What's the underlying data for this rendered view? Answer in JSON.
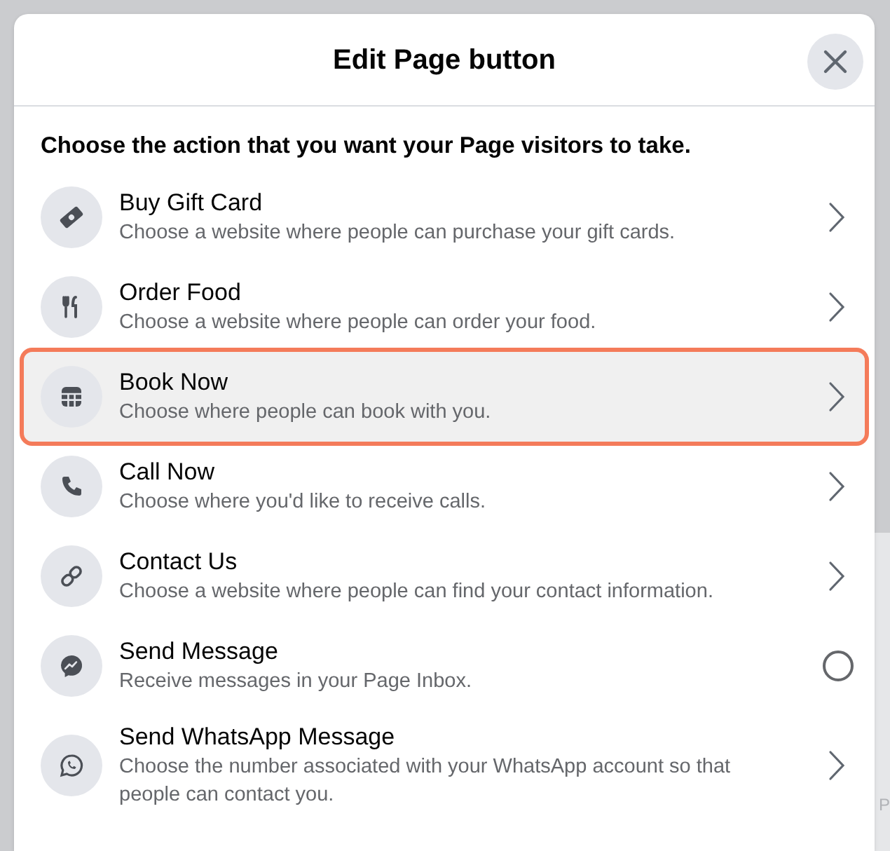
{
  "dialog": {
    "title": "Edit Page button",
    "prompt": "Choose the action that you want your Page visitors to take.",
    "options": [
      {
        "title": "Buy Gift Card",
        "description": "Choose a website where people can purchase your gift cards.",
        "kind": "chevron",
        "highlighted": false
      },
      {
        "title": "Order Food",
        "description": "Choose a website where people can order your food.",
        "kind": "chevron",
        "highlighted": false
      },
      {
        "title": "Book Now",
        "description": "Choose where people can book with you.",
        "kind": "chevron",
        "highlighted": true
      },
      {
        "title": "Call Now",
        "description": "Choose where you'd like to receive calls.",
        "kind": "chevron",
        "highlighted": false
      },
      {
        "title": "Contact Us",
        "description": "Choose a website where people can find your contact information.",
        "kind": "chevron",
        "highlighted": false
      },
      {
        "title": "Send Message",
        "description": "Receive messages in your Page Inbox.",
        "kind": "radio",
        "highlighted": false
      },
      {
        "title": "Send WhatsApp Message",
        "description": "Choose the number associated with your WhatsApp account so that people can contact you.",
        "kind": "chevron",
        "highlighted": false
      }
    ]
  },
  "background_text": "P"
}
